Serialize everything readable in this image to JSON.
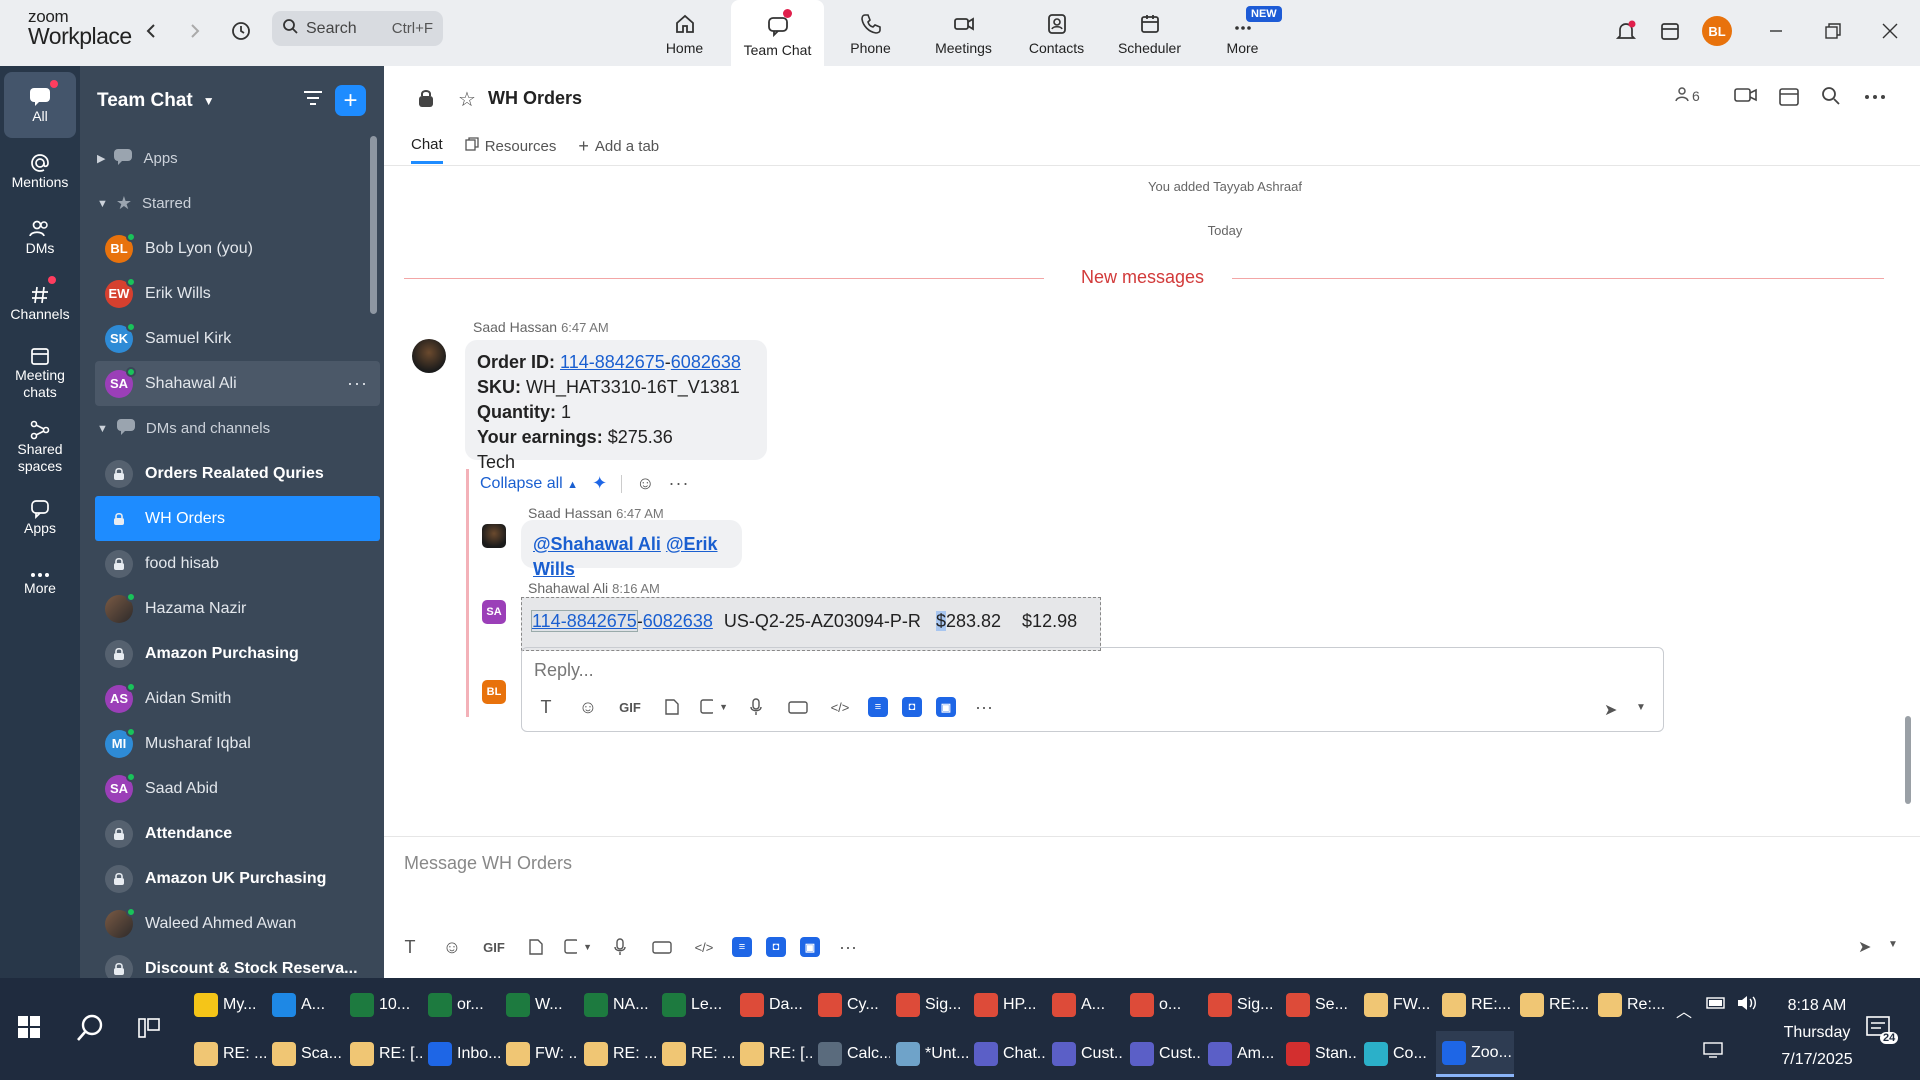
{
  "app": {
    "logo_line1": "zoom",
    "logo_line2": "Workplace"
  },
  "search": {
    "label": "Search",
    "shortcut": "Ctrl+F"
  },
  "topnav": [
    {
      "label": "Home",
      "icon": "home-icon"
    },
    {
      "label": "Team Chat",
      "icon": "chat-icon",
      "active": true
    },
    {
      "label": "Phone",
      "icon": "phone-icon"
    },
    {
      "label": "Meetings",
      "icon": "video-icon"
    },
    {
      "label": "Contacts",
      "icon": "contacts-icon"
    },
    {
      "label": "Scheduler",
      "icon": "calendar-icon"
    },
    {
      "label": "More",
      "icon": "more-icon",
      "badge": "NEW"
    }
  ],
  "user_initials": "BL",
  "rail": [
    {
      "label": "All"
    },
    {
      "label": "Mentions"
    },
    {
      "label": "DMs"
    },
    {
      "label": "Channels"
    },
    {
      "label": "Meeting chats"
    },
    {
      "label": "Shared spaces"
    },
    {
      "label": "Apps"
    },
    {
      "label": "More"
    }
  ],
  "sidebar": {
    "title": "Team Chat",
    "apps": "Apps",
    "starred": "Starred",
    "starred_items": [
      {
        "initials": "BL",
        "name": "Bob Lyon (you)",
        "color": "#e8720c"
      },
      {
        "initials": "EW",
        "name": "Erik Wills",
        "color": "#d6402f"
      },
      {
        "initials": "SK",
        "name": "Samuel Kirk",
        "color": "#2e8bd6"
      },
      {
        "initials": "SA",
        "name": "Shahawal Ali",
        "color": "#9b3fb8"
      }
    ],
    "dms_channels": "DMs and channels",
    "channels": [
      {
        "name": "Orders Realated Quries",
        "type": "lock",
        "bold": true
      },
      {
        "name": "WH Orders",
        "type": "lock",
        "selected": true
      },
      {
        "name": "food hisab",
        "type": "lock"
      },
      {
        "name": "Hazama Nazir",
        "type": "photo"
      },
      {
        "name": "Amazon Purchasing",
        "type": "lock",
        "bold": true
      },
      {
        "name": "Aidan Smith",
        "type": "avatar",
        "initials": "AS",
        "color": "#9b3fb8"
      },
      {
        "name": "Musharaf Iqbal",
        "type": "avatar",
        "initials": "MI",
        "color": "#2e8bd6"
      },
      {
        "name": "Saad Abid",
        "type": "avatar",
        "initials": "SA",
        "color": "#9b3fb8"
      },
      {
        "name": "Attendance",
        "type": "lock",
        "bold": true
      },
      {
        "name": "Amazon UK Purchasing",
        "type": "lock",
        "bold": true
      },
      {
        "name": "Waleed Ahmed Awan",
        "type": "photo"
      },
      {
        "name": "Discount & Stock Reserva...",
        "type": "lock",
        "bold": true
      }
    ]
  },
  "channel": {
    "title": "WH Orders",
    "members": "6",
    "tabs": {
      "chat": "Chat",
      "resources": "Resources",
      "add": "Add a tab"
    }
  },
  "messages": {
    "system": "You added Tayyab Ashraaf",
    "today": "Today",
    "new_messages": "New messages",
    "first": {
      "sender": "Saad Hassan",
      "time": "6:47 AM",
      "order_label": "Order ID:",
      "order_part1": "114-8842675",
      "order_dash": "-",
      "order_part2": "6082638",
      "sku_label": "SKU:",
      "sku": "WH_HAT3310-16T_V1381",
      "qty_label": "Quantity:",
      "qty": "1",
      "earn_label": "Your earnings:",
      "earn": "$275.36",
      "tail": "Tech"
    },
    "collapse": "Collapse all",
    "reply1": {
      "sender": "Saad Hassan",
      "time": "6:47 AM",
      "mention1": "@Shahawal Ali",
      "mention2": "@Erik Wills"
    },
    "reply2": {
      "sender": "Shahawal Ali",
      "time": "8:16 AM",
      "initials": "SA",
      "part1": "114-8842675",
      "dash": "-",
      "part2": "6082638",
      "ref": "US-Q2-25-AZ03094-P-R",
      "price_sel": "$",
      "price": "283.82",
      "fee": "$12.98"
    },
    "reply_placeholder": "Reply..."
  },
  "composer": {
    "placeholder": "Message WH Orders"
  },
  "taskbar": {
    "row1": [
      "My...",
      "A...",
      "10...",
      "or...",
      "W...",
      "NA...",
      "Le...",
      "Da...",
      "Cy...",
      "Sig...",
      "HP...",
      "A...",
      "o...",
      "Sig...",
      "Se...",
      "FW...",
      "RE:...",
      "RE:...",
      "Re:..."
    ],
    "row2": [
      "RE: ...",
      "Sca...",
      "RE: [...",
      "Inbo...",
      "FW: ...",
      "RE: ...",
      "RE: ...",
      "RE: [...",
      "Calc...",
      "*Unt...",
      "Chat...",
      "Cust...",
      "Cust...",
      "Am...",
      "Stan...",
      "Co...",
      "Zoo..."
    ],
    "time": "8:18 AM",
    "day": "Thursday",
    "date": "7/17/2025",
    "notif_count": "24"
  }
}
